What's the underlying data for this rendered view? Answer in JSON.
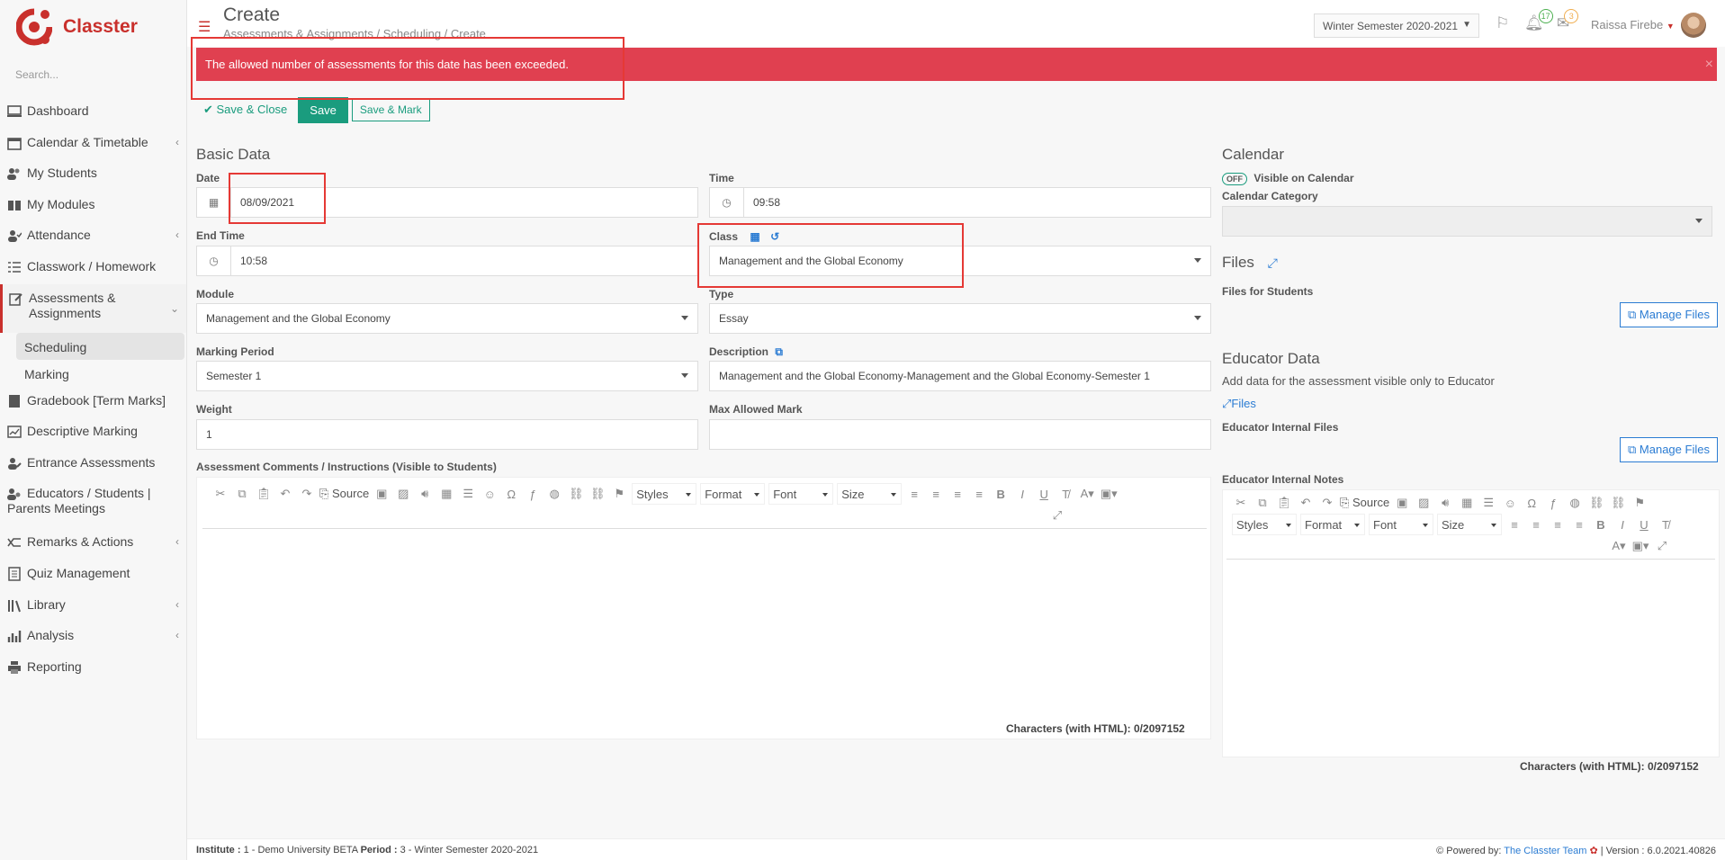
{
  "app": {
    "name": "Classter",
    "search_placeholder": "Search..."
  },
  "sidebar": {
    "items": [
      {
        "label": "Dashboard",
        "icon": "monitor-icon"
      },
      {
        "label": "Calendar & Timetable",
        "icon": "calendar-icon",
        "chevron": true
      },
      {
        "label": "My Students",
        "icon": "users-icon"
      },
      {
        "label": "My Modules",
        "icon": "book-icon"
      },
      {
        "label": "Attendance",
        "icon": "user-check-icon",
        "chevron": true
      },
      {
        "label": "Classwork / Homework",
        "icon": "list-icon"
      },
      {
        "label": "Assessments & Assignments",
        "icon": "edit-icon",
        "chevron": true,
        "active": true,
        "children": [
          {
            "label": "Scheduling",
            "selected": true
          },
          {
            "label": "Marking"
          }
        ]
      },
      {
        "label": "Gradebook [Term Marks]",
        "icon": "gradebook-icon"
      },
      {
        "label": "Descriptive Marking",
        "icon": "chart-icon"
      },
      {
        "label": "Entrance Assessments",
        "icon": "user-edit-icon"
      },
      {
        "label": "Educators / Students | Parents Meetings",
        "icon": "meeting-icon"
      },
      {
        "label": "Remarks & Actions",
        "icon": "shuffle-icon",
        "chevron": true
      },
      {
        "label": "Quiz Management",
        "icon": "quiz-icon"
      },
      {
        "label": "Library",
        "icon": "library-icon",
        "chevron": true
      },
      {
        "label": "Analysis",
        "icon": "bar-chart-icon",
        "chevron": true
      },
      {
        "label": "Reporting",
        "icon": "printer-icon"
      }
    ]
  },
  "header": {
    "title": "Create",
    "breadcrumb": "Assessments & Assignments  /  Scheduling  /  Create",
    "semester": "Winter Semester 2020-2021",
    "flag_icon": "flag-icon",
    "notifications_count": "17",
    "messages_count": "3",
    "user_name": "Raissa Firebe"
  },
  "alert": {
    "message": "The allowed number of assessments for this date has been exceeded.",
    "close": "×",
    "color": "#e04050"
  },
  "toolbar": {
    "save_close": "Save & Close",
    "save": "Save",
    "save_mark": "Save & Mark"
  },
  "basic": {
    "heading": "Basic Data",
    "date_label": "Date",
    "date_value": "08/09/2021",
    "time_label": "Time",
    "time_value": "09:58",
    "end_time_label": "End Time",
    "end_time_value": "10:58",
    "class_label": "Class",
    "class_value": "Management and the Global Economy",
    "module_label": "Module",
    "module_value": "Management and the Global Economy",
    "type_label": "Type",
    "type_value": "Essay",
    "marking_period_label": "Marking Period",
    "marking_period_value": "Semester 1",
    "description_label": "Description",
    "description_value": "Management and the Global Economy-Management and the Global Economy-Semester 1",
    "weight_label": "Weight",
    "weight_value": "1",
    "max_mark_label": "Max Allowed Mark",
    "max_mark_value": "",
    "comments_label": "Assessment Comments / Instructions (Visible to Students)"
  },
  "editor": {
    "source": "Source",
    "styles": "Styles",
    "format": "Format",
    "font": "Font",
    "size": "Size",
    "chars": "Characters (with HTML): 0/2097152"
  },
  "calendar": {
    "heading": "Calendar",
    "toggle": "OFF",
    "visible_label": "Visible on Calendar",
    "category_label": "Calendar Category",
    "category_value": ""
  },
  "files": {
    "heading": "Files",
    "for_students": "Files for Students",
    "manage": "Manage Files"
  },
  "educator": {
    "heading": "Educator Data",
    "desc": "Add data for the assessment visible only to Educator",
    "files_link": "Files",
    "internal_files": "Educator Internal Files",
    "manage": "Manage Files",
    "notes_label": "Educator Internal Notes",
    "chars": "Characters (with HTML): 0/2097152"
  },
  "footer": {
    "institute_label": "Institute :",
    "institute_value": "1 - Demo University BETA",
    "period_label": "Period :",
    "period_value": "3 - Winter Semester 2020-2021",
    "powered": "Powered by:",
    "team": "The Classter Team",
    "version": "| Version : 6.0.2021.40826"
  }
}
